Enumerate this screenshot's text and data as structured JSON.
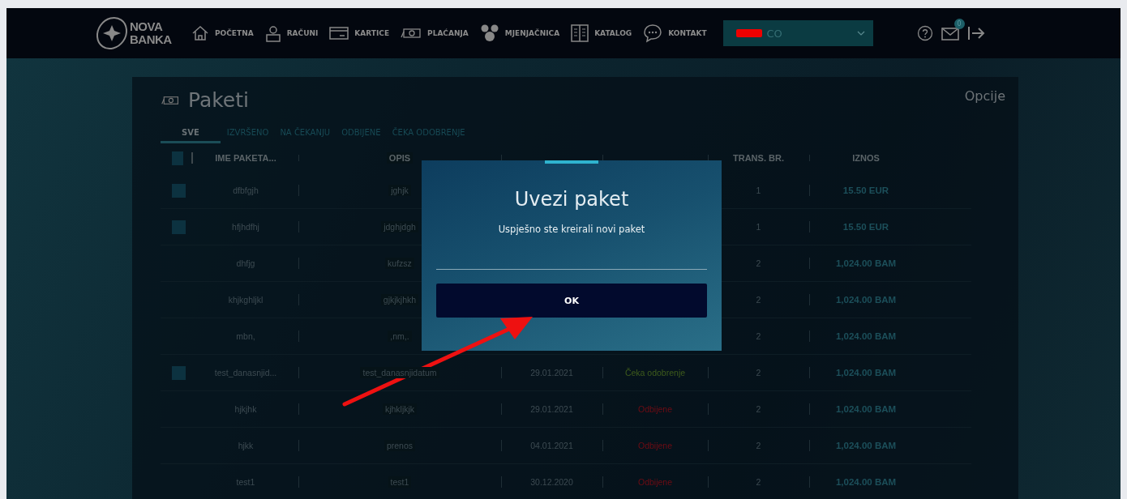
{
  "nav": {
    "logo": "NOVA BANKA",
    "items": [
      {
        "label": "POČETNA"
      },
      {
        "label": "RAČUNI"
      },
      {
        "label": "KARTICE"
      },
      {
        "label": "PLAĆANJA"
      },
      {
        "label": "MJENJAČNICA"
      },
      {
        "label": "KATALOG"
      },
      {
        "label": "KONTAKT"
      }
    ],
    "account_select": {
      "value": "CO"
    },
    "mail_badge": "0"
  },
  "page": {
    "title": "Paketi",
    "options": "Opcije",
    "tabs": [
      {
        "label": "SVE",
        "selected": true
      },
      {
        "label": "IZVRŠENO",
        "selected": false
      },
      {
        "label": "NA ČEKANJU",
        "selected": false
      },
      {
        "label": "ODBIJENE",
        "selected": false
      },
      {
        "label": "ČEKA ODOBRENJE",
        "selected": false
      }
    ],
    "select_all": {
      "checked": false
    },
    "columns": {
      "name": "IME PAKETA...",
      "description": "OPIS",
      "trans": "TRANS. BR.",
      "amount": "IZNOS"
    },
    "rows": [
      {
        "kind": "checkable",
        "checked": false,
        "name": "dfbfgjh",
        "description": "jghjk",
        "trans": "1",
        "amount": "15.50 EUR"
      },
      {
        "kind": "checkable",
        "checked": false,
        "name": "hfjhdfhj",
        "description": "jdghjdgh",
        "trans": "1",
        "amount": "15.50 EUR"
      },
      {
        "kind": "plain",
        "name": "dhfjg",
        "description": "kufzsz",
        "trans": "2",
        "amount": "1,024.00 BAM"
      },
      {
        "kind": "plain",
        "name": "khjkghljkl",
        "description": "gjkjkjhkh",
        "trans": "2",
        "amount": "1,024.00 BAM"
      },
      {
        "kind": "plain",
        "name": "mbn,",
        "description": ",nm,.",
        "trans": "2",
        "amount": "1,024.00 BAM"
      },
      {
        "kind": "checkable",
        "checked": false,
        "name": "test_danasnjid...",
        "description": "test_danasnjidatum",
        "date": "29.01.2021",
        "status": "Čeka odobrenje",
        "color": "#3f5c1c",
        "trans": "2",
        "amount": "1,024.00 BAM"
      },
      {
        "kind": "plain",
        "name": "hjkjhk",
        "description": "kjhkljkjk",
        "date": "29.01.2021",
        "status": "Odbijene",
        "color": "#6e0c14",
        "trans": "2",
        "amount": "1,024.00 BAM"
      },
      {
        "kind": "plain",
        "name": "hjkk",
        "description": "prenos",
        "date": "04.01.2021",
        "status": "Odbijene",
        "color": "#6e0c14",
        "trans": "2",
        "amount": "1,024.00 BAM"
      },
      {
        "kind": "plain",
        "name": "test1",
        "description": "test1",
        "date": "30.12.2020",
        "status": "Odbijene",
        "color": "#6e0c14",
        "trans": "2",
        "amount": "1,024.00 BAM"
      }
    ]
  },
  "dialog": {
    "title": "Uvezi paket",
    "message": "Uspješno ste kreirali novi paket",
    "button": "OK"
  }
}
